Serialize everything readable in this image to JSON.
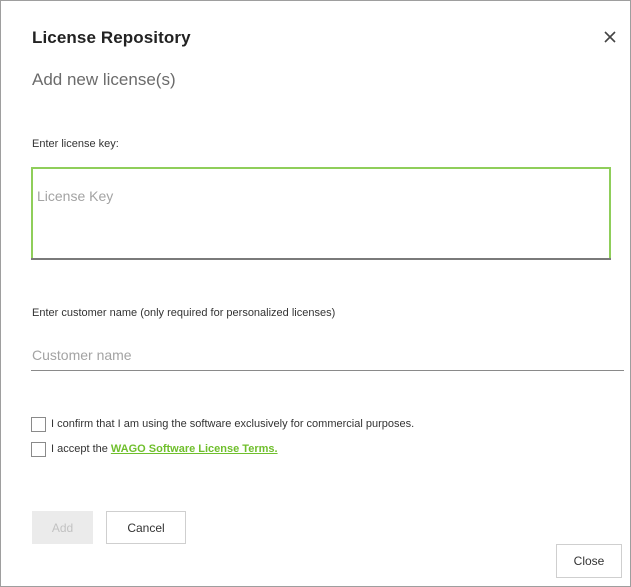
{
  "dialog": {
    "title": "License Repository",
    "close_icon": "close-icon",
    "subtitle": "Add new license(s)"
  },
  "license_key": {
    "label": "Enter license key:",
    "placeholder": "License Key",
    "value": ""
  },
  "customer": {
    "label": "Enter customer name (only required for personalized licenses)",
    "placeholder": "Customer name",
    "value": ""
  },
  "checkboxes": [
    {
      "text": "I confirm that I am using the software exclusively for commercial purposes.",
      "checked": false
    },
    {
      "text": "I accept the",
      "link_text": "WAGO Software License Terms.",
      "checked": false
    }
  ],
  "buttons": {
    "add": "Add",
    "cancel": "Cancel",
    "close": "Close"
  },
  "colors": {
    "accent_green": "#8fce5a",
    "link_green": "#6fbf2c"
  }
}
